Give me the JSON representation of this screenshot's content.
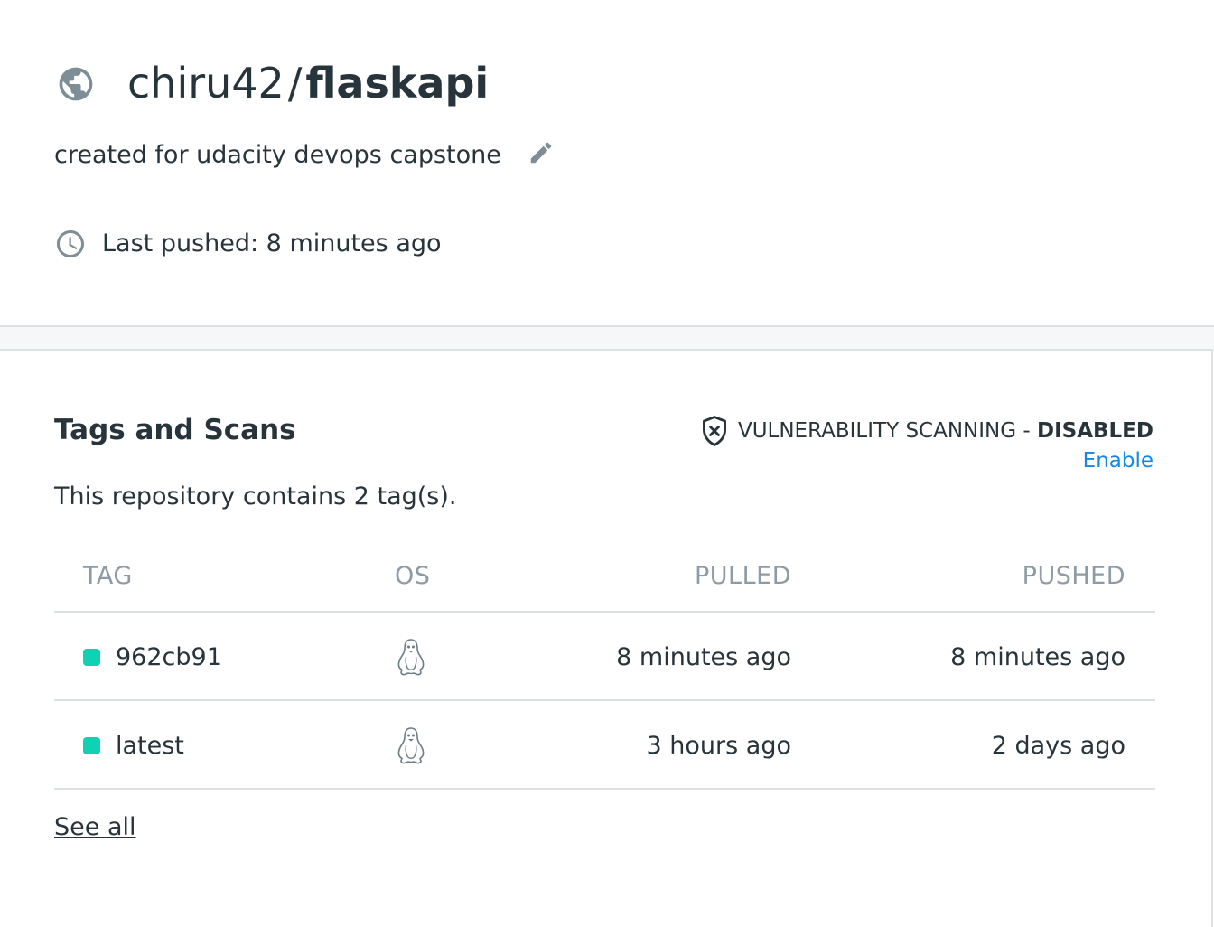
{
  "repo": {
    "namespace": "chiru42",
    "separator": "/",
    "name": "flaskapi",
    "description": "created for udacity devops capstone",
    "last_pushed": "Last pushed: 8 minutes ago",
    "visibility_icon": "globe-icon"
  },
  "tags_section": {
    "title": "Tags and Scans",
    "vulnerability_label": "VULNERABILITY SCANNING - ",
    "vulnerability_status": "DISABLED",
    "enable_link": "Enable",
    "summary": "This repository contains 2 tag(s).",
    "columns": {
      "tag": "TAG",
      "os": "OS",
      "pulled": "PULLED",
      "pushed": "PUSHED"
    },
    "rows": [
      {
        "tag": "962cb91",
        "os_icon": "linux-icon",
        "pulled": "8 minutes ago",
        "pushed": "8 minutes ago"
      },
      {
        "tag": "latest",
        "os_icon": "linux-icon",
        "pulled": "3 hours ago",
        "pushed": "2 days ago"
      }
    ],
    "see_all": "See all"
  },
  "colors": {
    "text": "#27343b",
    "muted": "#8c9ba5",
    "link": "#1488e4",
    "status_dot": "#10d1b2",
    "divider": "#dce1e4"
  }
}
